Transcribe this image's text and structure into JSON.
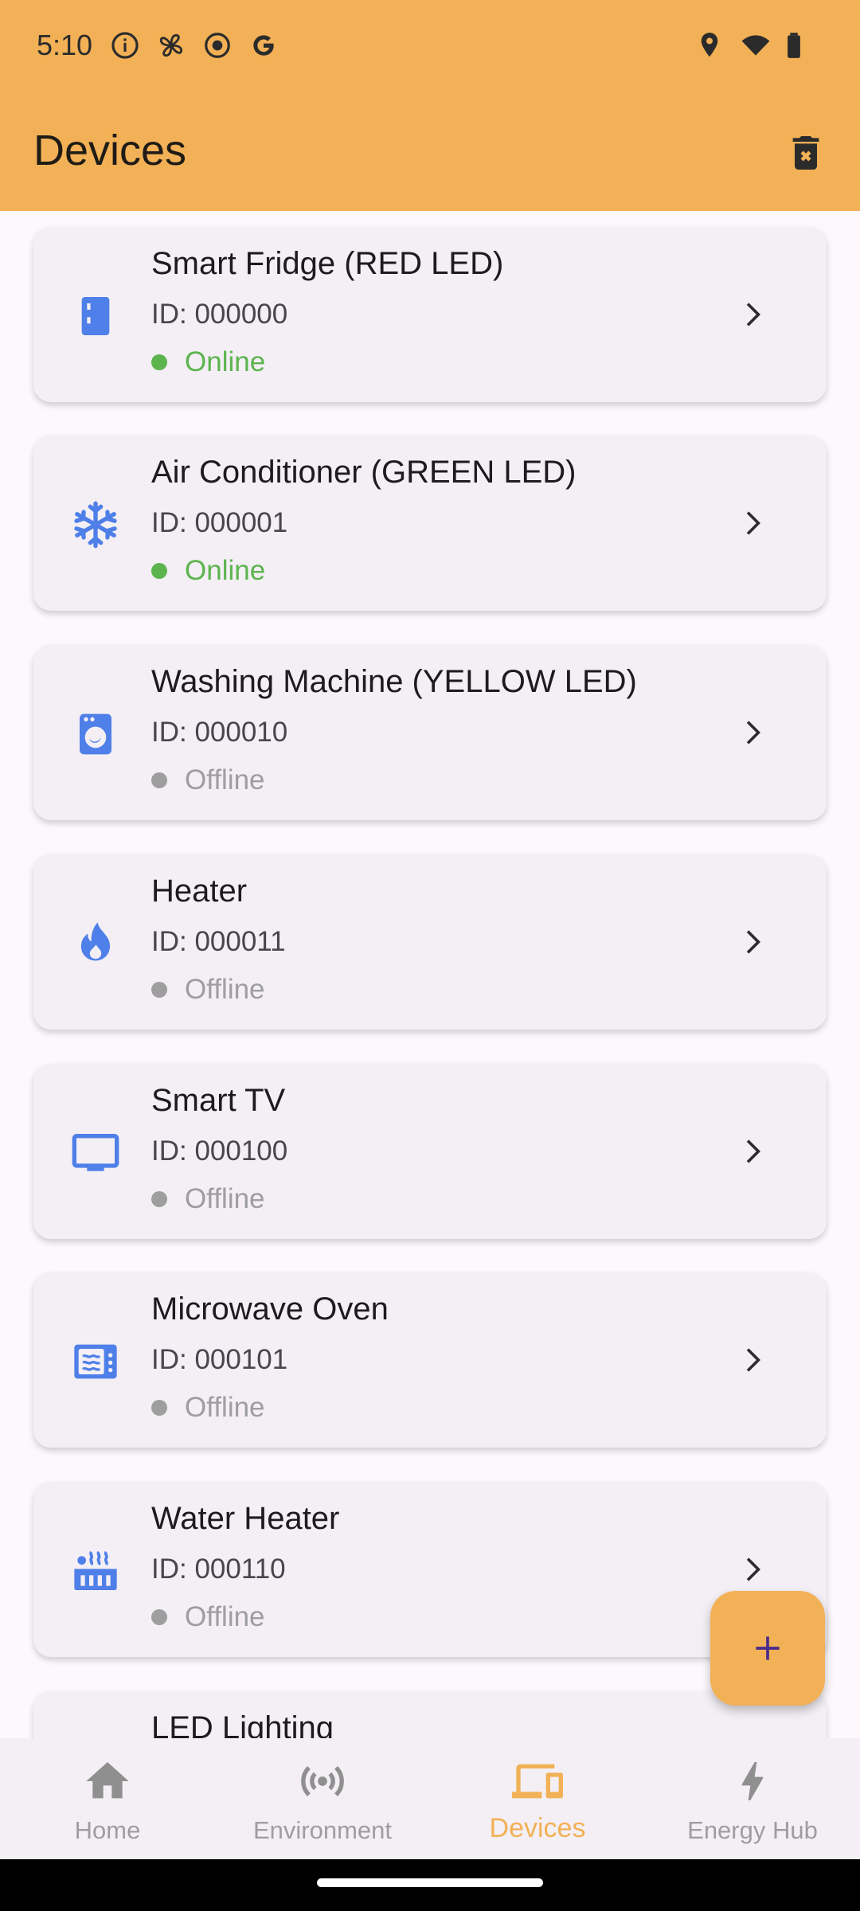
{
  "status_bar": {
    "time": "5:10",
    "left_icons": [
      "info-icon",
      "fan-icon",
      "record-icon",
      "google-icon"
    ],
    "right_icons": [
      "location-icon",
      "wifi-icon",
      "battery-icon"
    ]
  },
  "app_bar": {
    "title": "Devices",
    "action_icon": "delete-icon"
  },
  "devices": [
    {
      "name": "Smart Fridge (RED LED)",
      "id": "ID: 000000",
      "status": "Online",
      "icon": "fridge-icon"
    },
    {
      "name": "Air Conditioner (GREEN LED)",
      "id": "ID: 000001",
      "status": "Online",
      "icon": "snowflake-icon"
    },
    {
      "name": "Washing Machine (YELLOW LED)",
      "id": "ID: 000010",
      "status": "Offline",
      "icon": "washing-machine-icon"
    },
    {
      "name": "Heater",
      "id": "ID: 000011",
      "status": "Offline",
      "icon": "flame-icon"
    },
    {
      "name": "Smart TV",
      "id": "ID: 000100",
      "status": "Offline",
      "icon": "tv-icon"
    },
    {
      "name": "Microwave Oven",
      "id": "ID: 000101",
      "status": "Offline",
      "icon": "microwave-icon"
    },
    {
      "name": "Water Heater",
      "id": "ID: 000110",
      "status": "Offline",
      "icon": "hot-tub-icon"
    },
    {
      "name": "LED Lighting",
      "id": "",
      "status": "",
      "icon": ""
    }
  ],
  "fab": {
    "icon": "add-icon"
  },
  "bottom_nav": [
    {
      "label": "Home",
      "icon": "home-icon",
      "active": false
    },
    {
      "label": "Environment",
      "icon": "sensors-icon",
      "active": false
    },
    {
      "label": "Devices",
      "icon": "devices-icon",
      "active": true
    },
    {
      "label": "Energy Hub",
      "icon": "bolt-icon",
      "active": false
    }
  ],
  "colors": {
    "primary": "#f2b156",
    "device_icon": "#4f7fe8",
    "online": "#5cb44e",
    "offline": "#9e9e9e",
    "card_bg": "#f3eff4",
    "fab_plus": "#4a2c8a"
  }
}
